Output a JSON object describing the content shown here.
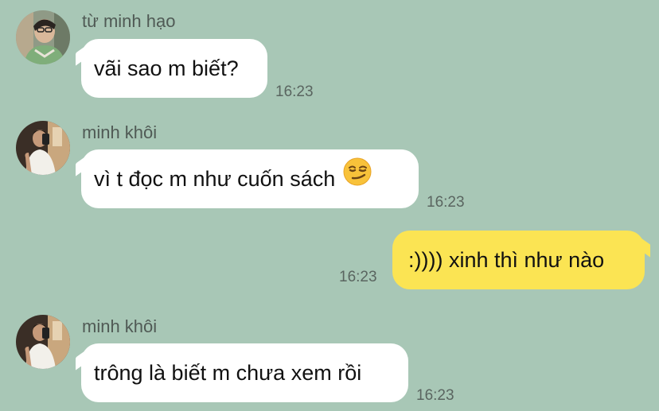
{
  "chat": {
    "background": "#a8c7b6",
    "messages": [
      {
        "sender": "từ minh hạo",
        "text": "vãi sao m biết?",
        "time": "16:23",
        "direction": "incoming",
        "avatar": "avatar-tu-minh-hao"
      },
      {
        "sender": "minh khôi",
        "text": "vì t đọc m như cuốn sách",
        "emoji": "smirking-face-emoji",
        "time": "16:23",
        "direction": "incoming",
        "avatar": "avatar-minh-khoi"
      },
      {
        "sender": "",
        "text": ":)))) xinh thì như nào",
        "time": "16:23",
        "direction": "outgoing",
        "bubble_color": "#fbe453"
      },
      {
        "sender": "minh khôi",
        "text": "trông là biết m chưa xem rồi",
        "time": "16:23",
        "direction": "incoming",
        "avatar": "avatar-minh-khoi"
      }
    ]
  }
}
